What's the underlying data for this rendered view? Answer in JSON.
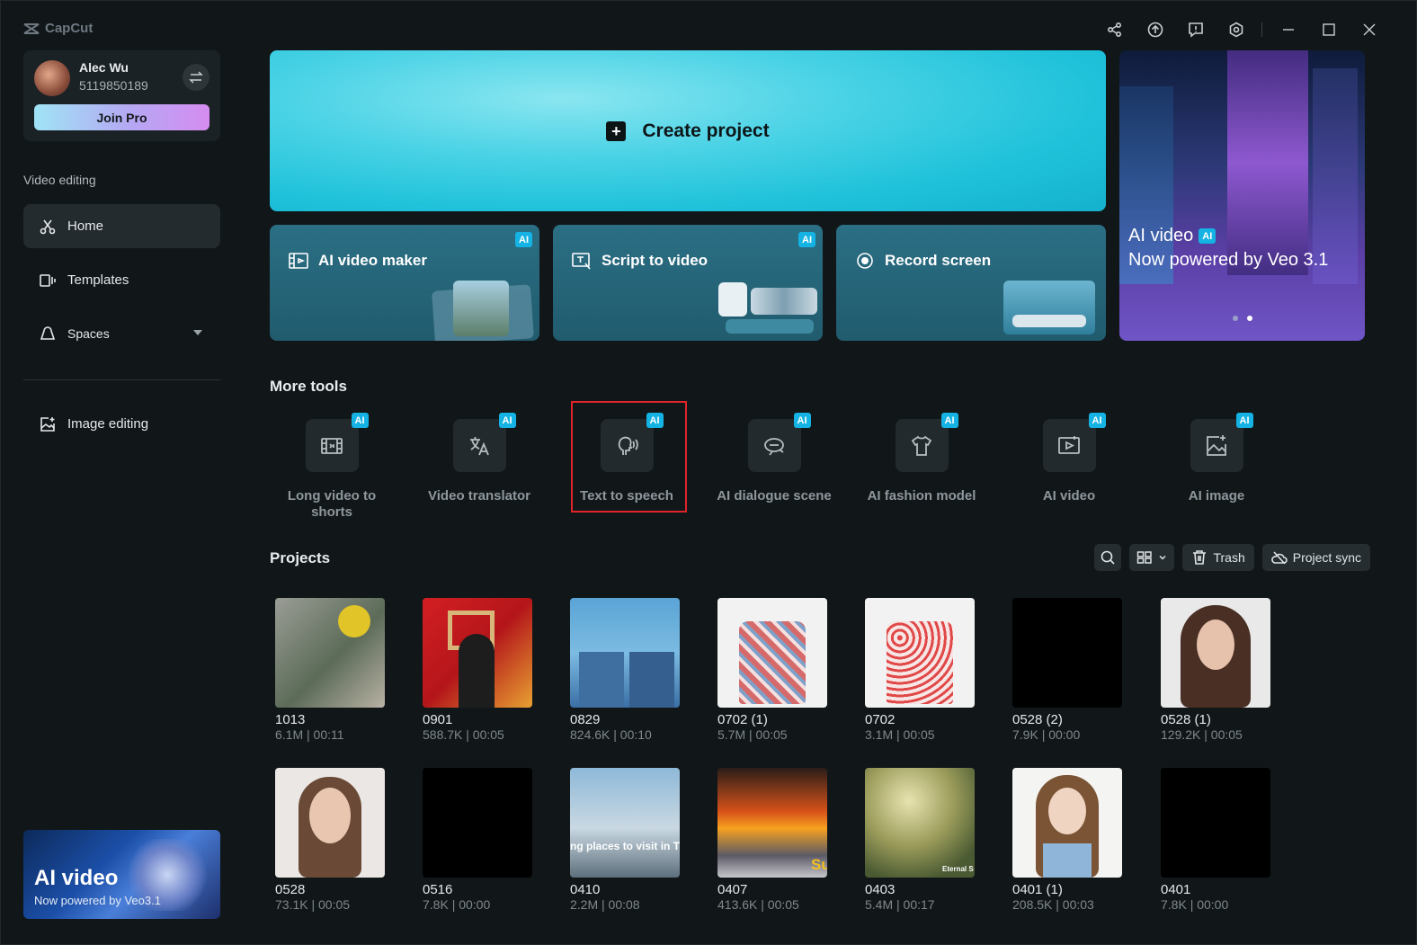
{
  "app": {
    "name": "CapCut"
  },
  "user": {
    "name": "Alec Wu",
    "id": "5119850189",
    "join_pro": "Join Pro"
  },
  "sidebar": {
    "section_label": "Video editing",
    "items": [
      {
        "label": "Home",
        "icon": "scissors-icon"
      },
      {
        "label": "Templates",
        "icon": "templates-icon"
      },
      {
        "label": "Spaces",
        "icon": "cloud-icon"
      },
      {
        "label": "Image editing",
        "icon": "image-edit-icon"
      }
    ],
    "promo": {
      "title": "AI video",
      "subtitle": "Now powered by Veo3.1"
    }
  },
  "create": {
    "label": "Create project"
  },
  "tools": [
    {
      "label": "AI video maker",
      "badge": "AI"
    },
    {
      "label": "Script to video",
      "badge": "AI"
    },
    {
      "label": "Record screen"
    }
  ],
  "hero": {
    "title": "AI video",
    "badge": "AI",
    "subtitle": "Now powered by Veo 3.1"
  },
  "more_tools": {
    "title": "More tools",
    "items": [
      {
        "label": "Long video to shorts",
        "badge": "AI"
      },
      {
        "label": "Video translator",
        "badge": "AI"
      },
      {
        "label": "Text to speech",
        "badge": "AI"
      },
      {
        "label": "AI dialogue scene",
        "badge": "AI"
      },
      {
        "label": "AI fashion model",
        "badge": "AI"
      },
      {
        "label": "AI video",
        "badge": "AI"
      },
      {
        "label": "AI image",
        "badge": "AI"
      }
    ]
  },
  "projects": {
    "title": "Projects",
    "trash": "Trash",
    "sync": "Project sync",
    "items": [
      {
        "name": "1013",
        "meta": "6.1M | 00:11"
      },
      {
        "name": "0901",
        "meta": "588.7K | 00:05"
      },
      {
        "name": "0829",
        "meta": "824.6K | 00:10"
      },
      {
        "name": "0702 (1)",
        "meta": "5.7M | 00:05"
      },
      {
        "name": "0702",
        "meta": "3.1M | 00:05"
      },
      {
        "name": "0528 (2)",
        "meta": "7.9K | 00:00"
      },
      {
        "name": "0528 (1)",
        "meta": "129.2K | 00:05"
      },
      {
        "name": "0528",
        "meta": "73.1K | 00:05"
      },
      {
        "name": "0516",
        "meta": "7.8K | 00:00"
      },
      {
        "name": "0410",
        "meta": "2.2M | 00:08",
        "overlay": "ng places to visit in T"
      },
      {
        "name": "0407",
        "meta": "413.6K | 00:05",
        "overlay": "Su"
      },
      {
        "name": "0403",
        "meta": "5.4M | 00:17",
        "overlay": "Eternal S"
      },
      {
        "name": "0401 (1)",
        "meta": "208.5K | 00:03"
      },
      {
        "name": "0401",
        "meta": "7.8K | 00:00"
      }
    ]
  }
}
